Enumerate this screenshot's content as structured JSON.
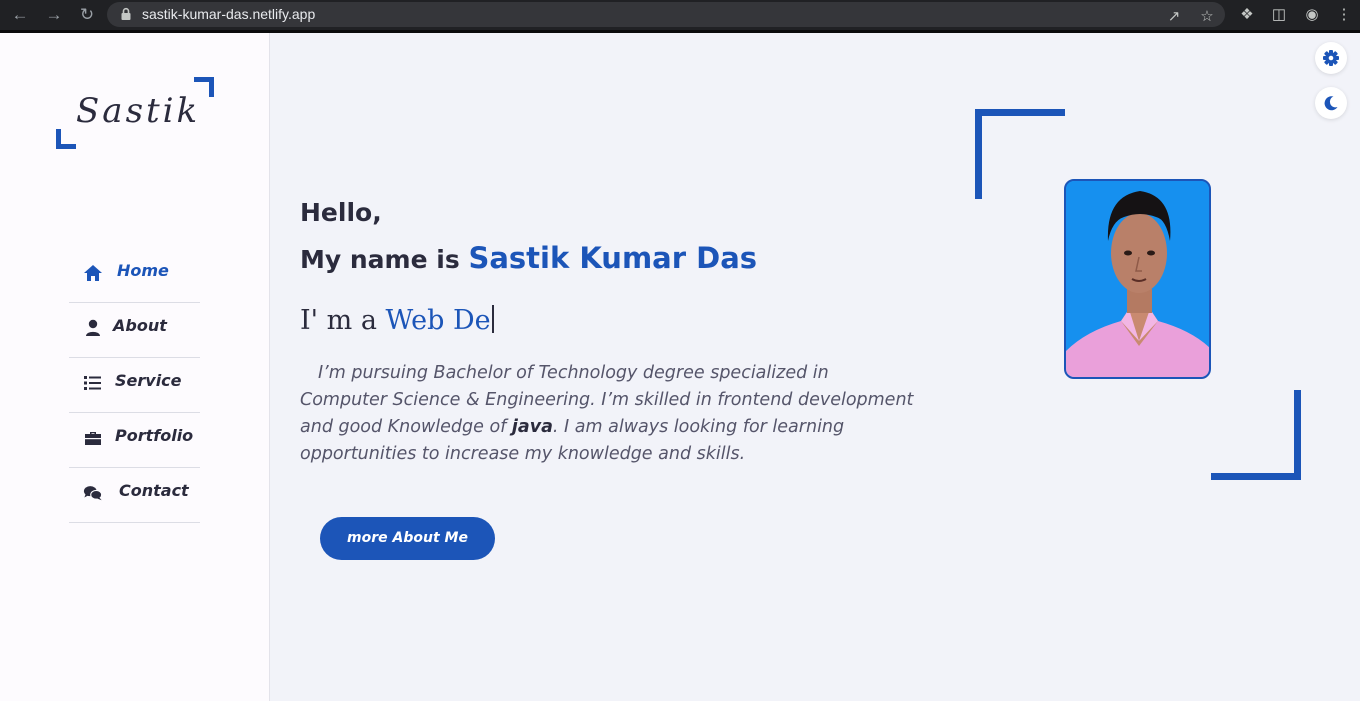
{
  "browser": {
    "url": "sastik-kumar-das.netlify.app"
  },
  "logo": {
    "text": "Sastik"
  },
  "nav": [
    {
      "label": "Home",
      "icon": "home-icon",
      "active": true
    },
    {
      "label": "About",
      "icon": "user-icon",
      "active": false
    },
    {
      "label": "Service",
      "icon": "list-icon",
      "active": false
    },
    {
      "label": "Portfolio",
      "icon": "briefcase-icon",
      "active": false
    },
    {
      "label": "Contact",
      "icon": "chat-icon",
      "active": false
    }
  ],
  "hero": {
    "greeting": "Hello,",
    "name_prefix": "My name is",
    "name": "Sastik Kumar Das",
    "typed_prefix": "I' m a",
    "typed_text": "Web De",
    "bio_before": "I’m pursuing Bachelor of Technology degree specialized in Computer Science & Engineering. I’m skilled in frontend development and good Knowledge of",
    "bio_emphasis": "java",
    "bio_after": ". I am always looking for learning opportunities to increase my knowledge and skills.",
    "button_label": "more About Me"
  },
  "controls": {
    "settings_icon": "gear-icon",
    "theme_icon": "moon-icon"
  },
  "colors": {
    "accent": "#1c55b8",
    "text": "#2b2b3d",
    "background": "#f2f3f9",
    "sidebar": "#fdfbfe"
  }
}
